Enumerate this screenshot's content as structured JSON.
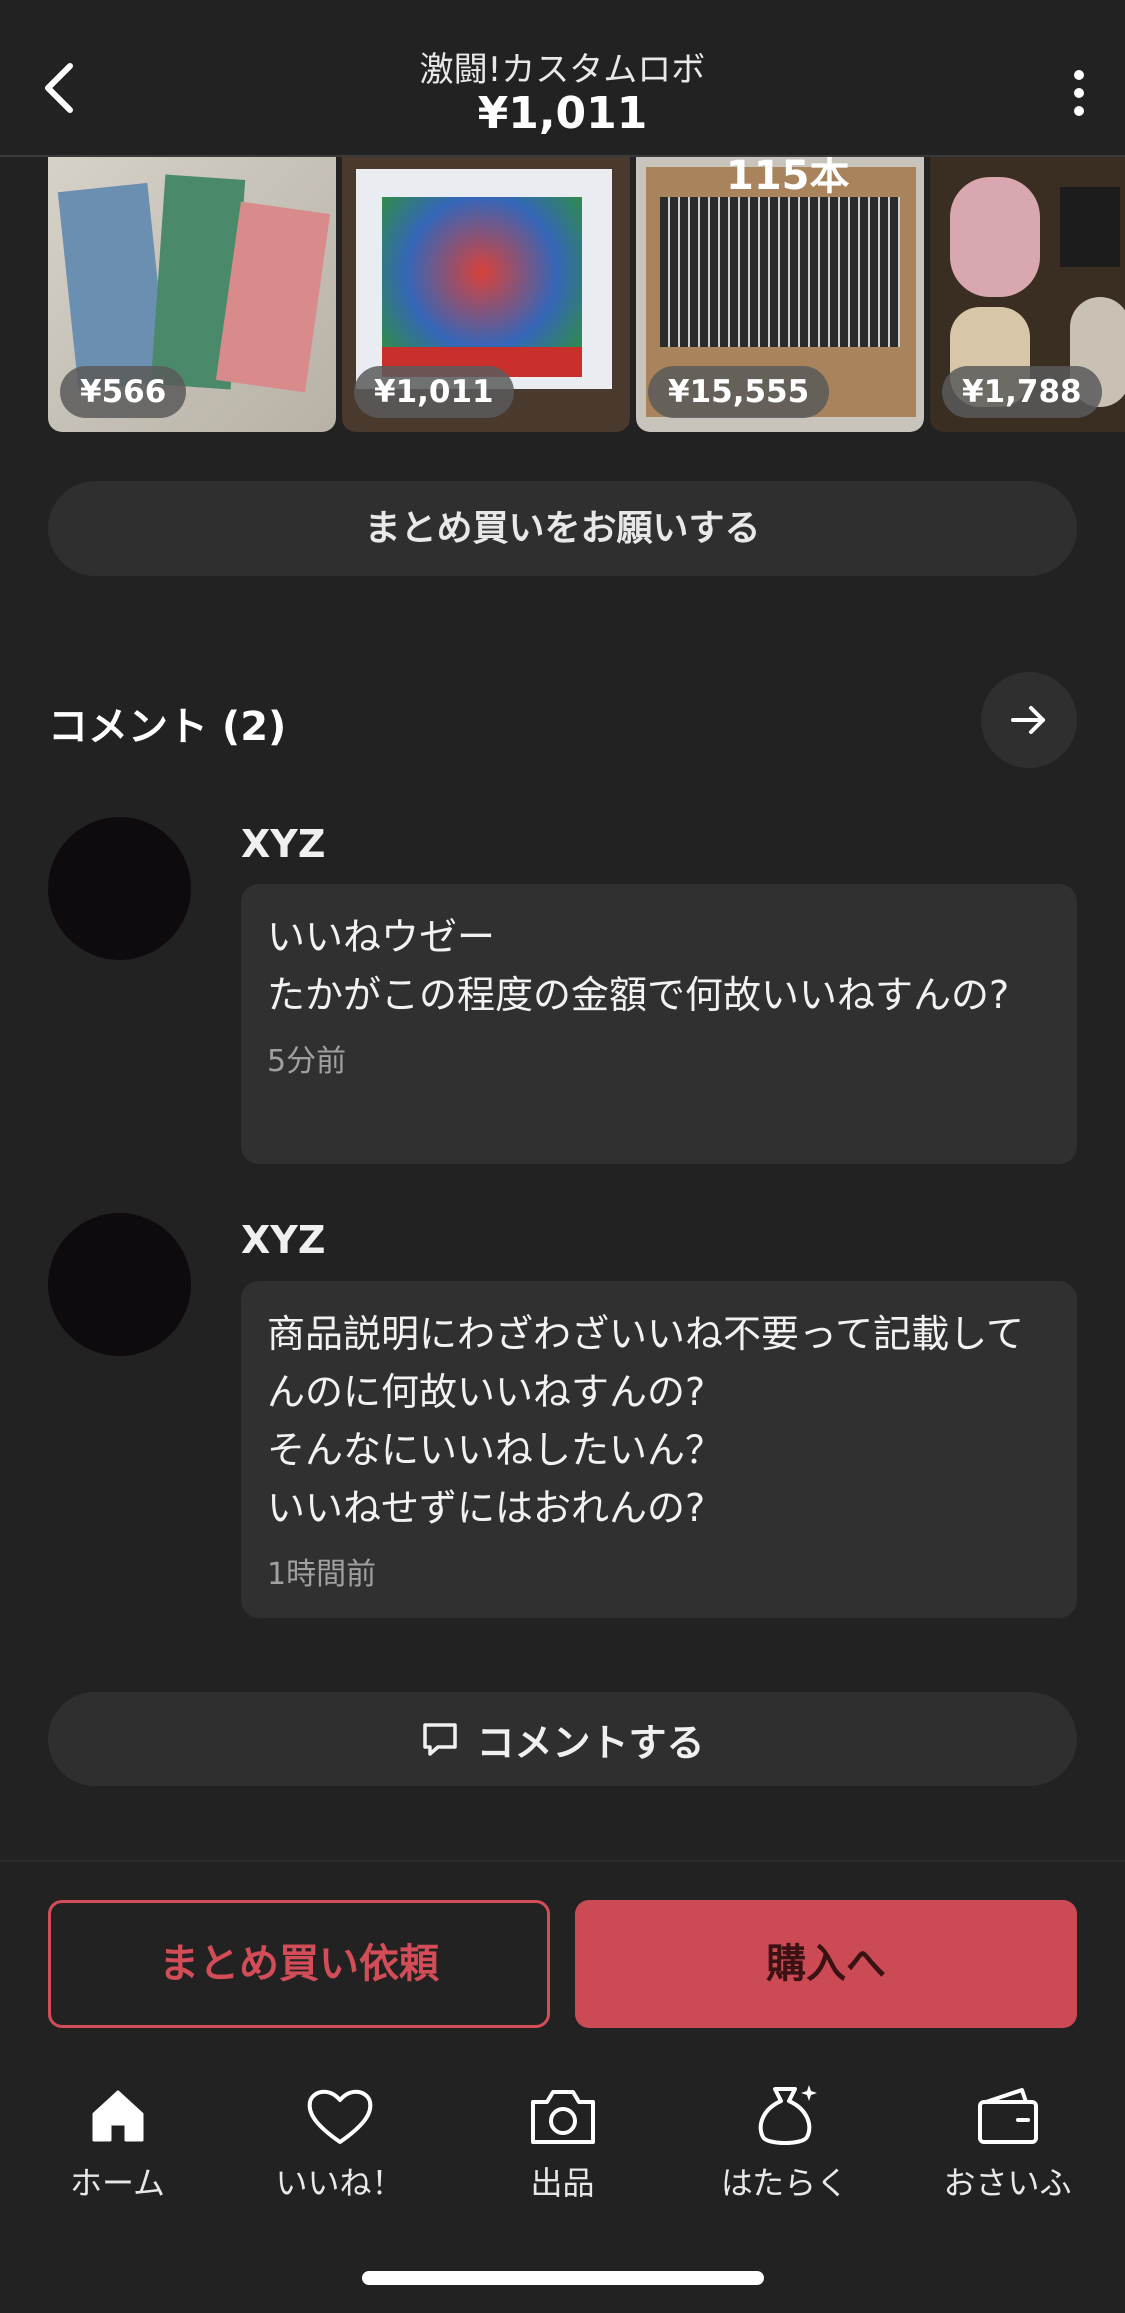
{
  "header": {
    "title": "激闘!カスタムロボ",
    "price": "¥1,011"
  },
  "thumbnails": [
    {
      "price": "¥566"
    },
    {
      "price": "¥1,011"
    },
    {
      "price": "¥15,555",
      "overlay_text": "115本"
    },
    {
      "price": "¥1,788"
    }
  ],
  "bundle_button": "まとめ買いをお願いする",
  "comments": {
    "title": "コメント (2)",
    "items": [
      {
        "user": "XYZ",
        "text": "いいねウゼー\nたかがこの程度の金額で何故いいねすんの?",
        "time": "5分前"
      },
      {
        "user": "XYZ",
        "text": "商品説明にわざわざいいね不要って記載してんのに何故いいねすんの?\nそんなにいいねしたいん？\nいいねせずにはおれんの?",
        "time": "1時間前"
      }
    ],
    "write_button": "コメントする"
  },
  "actions": {
    "bundle_request": "まとめ買い依頼",
    "buy": "購入へ"
  },
  "tabs": [
    {
      "label": "ホーム",
      "icon": "home-icon"
    },
    {
      "label": "いいね！",
      "icon": "heart-icon"
    },
    {
      "label": "出品",
      "icon": "camera-icon"
    },
    {
      "label": "はたらく",
      "icon": "money-bag-icon"
    },
    {
      "label": "おさいふ",
      "icon": "wallet-icon"
    }
  ],
  "colors": {
    "background": "#222222",
    "accent": "#cc4a54"
  }
}
